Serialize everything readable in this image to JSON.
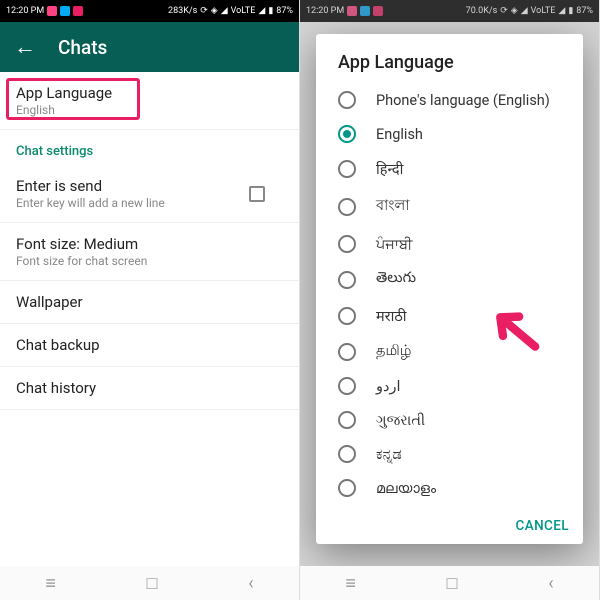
{
  "left": {
    "status": {
      "time": "12:20 PM",
      "speed": "283K/s",
      "volte": "VoLTE",
      "battery": "87%"
    },
    "appbar_title": "Chats",
    "app_language": {
      "label": "App Language",
      "sub": "English"
    },
    "section_header": "Chat settings",
    "enter_is_send": {
      "label": "Enter is send",
      "sub": "Enter key will add a new line"
    },
    "font_size": {
      "label": "Font size: Medium",
      "sub": "Font size for chat screen"
    },
    "wallpaper": {
      "label": "Wallpaper"
    },
    "chat_backup": {
      "label": "Chat backup"
    },
    "chat_history": {
      "label": "Chat history"
    }
  },
  "right": {
    "status": {
      "time": "12:20 PM",
      "speed": "70.0K/s",
      "volte": "VoLTE",
      "battery": "87%"
    },
    "dialog_title": "App Language",
    "options": [
      "Phone's language (English)",
      "English",
      "हिन्दी",
      "বাংলা",
      "ਪੰਜਾਬੀ",
      "తెలుగు",
      "मराठी",
      "தமிழ்",
      "اردو",
      "ગુજરાતી",
      "ಕನ್ನಡ",
      "മലയാളം"
    ],
    "selected_index": 1,
    "cancel": "CANCEL"
  }
}
